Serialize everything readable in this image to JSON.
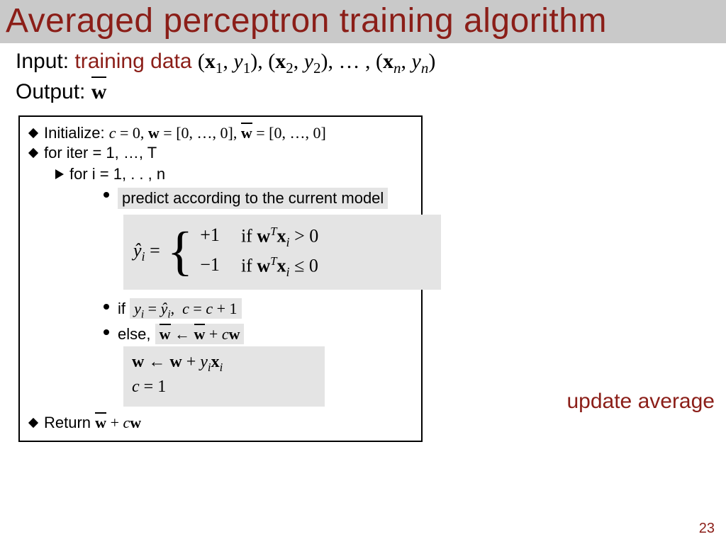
{
  "title": "Averaged perceptron training algorithm",
  "input_label": "Input:",
  "input_highlight": "training data",
  "input_math": "(x₁, y₁), (x₂, y₂), …, (xₙ, yₙ)",
  "output_label": "Output:",
  "output_math": "w̄",
  "algo": {
    "init_label": "Initialize:",
    "init_math": "c = 0, w = [0, …, 0], w̄ = [0, …, 0]",
    "for_outer": "for iter = 1, …, T",
    "for_inner": "for i = 1, . . , n",
    "predict": "predict according to the current model",
    "yhat_lhs": "ŷᵢ =",
    "case_p1": "+1",
    "case_p1_cond": "if wᵀxᵢ > 0",
    "case_m1": "−1",
    "case_m1_cond": "if wᵀxᵢ ≤ 0",
    "if_label": "if",
    "if_math": "yᵢ = ŷᵢ,  c = c + 1",
    "else_label": "else,",
    "else_math1": "w̄ ← w̄ + c w",
    "else_math2": "w ← w + yᵢ xᵢ",
    "else_math3": "c = 1",
    "return_label": "Return",
    "return_math": "w̄ + c w"
  },
  "annotation": "update average",
  "page_number": "23"
}
